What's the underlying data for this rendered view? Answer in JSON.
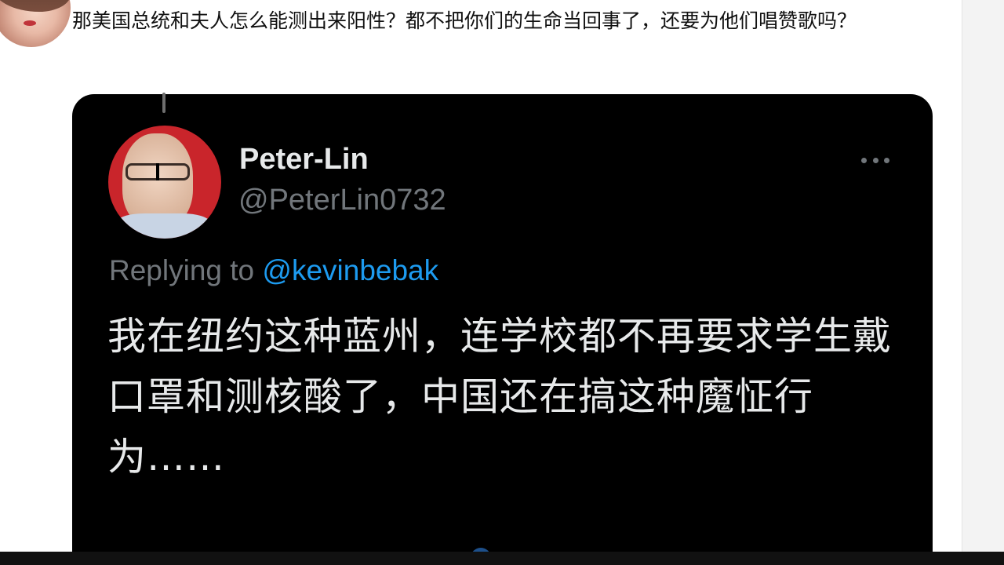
{
  "outer_tweet": {
    "text": "那美国总统和夫人怎么能测出来阳性？都不把你们的生命当回事了，还要为他们唱赞歌吗？"
  },
  "quoted_tweet": {
    "display_name": "Peter-Lin",
    "handle": "@PeterLin0732",
    "replying_prefix": "Replying to ",
    "replying_to": "@kevinbebak",
    "text": "我在纽约这种蓝州，连学校都不再要求学生戴口罩和测核酸了，中国还在搞这种魔怔行为……",
    "more_icon": "more-dots-icon"
  },
  "colors": {
    "outer_background": "#ffffff",
    "embed_background": "#000000",
    "primary_text_dark": "#e7e9ea",
    "secondary_text": "#71767b",
    "mention_blue": "#1d9bf0",
    "avatar_red": "#c9252b"
  }
}
